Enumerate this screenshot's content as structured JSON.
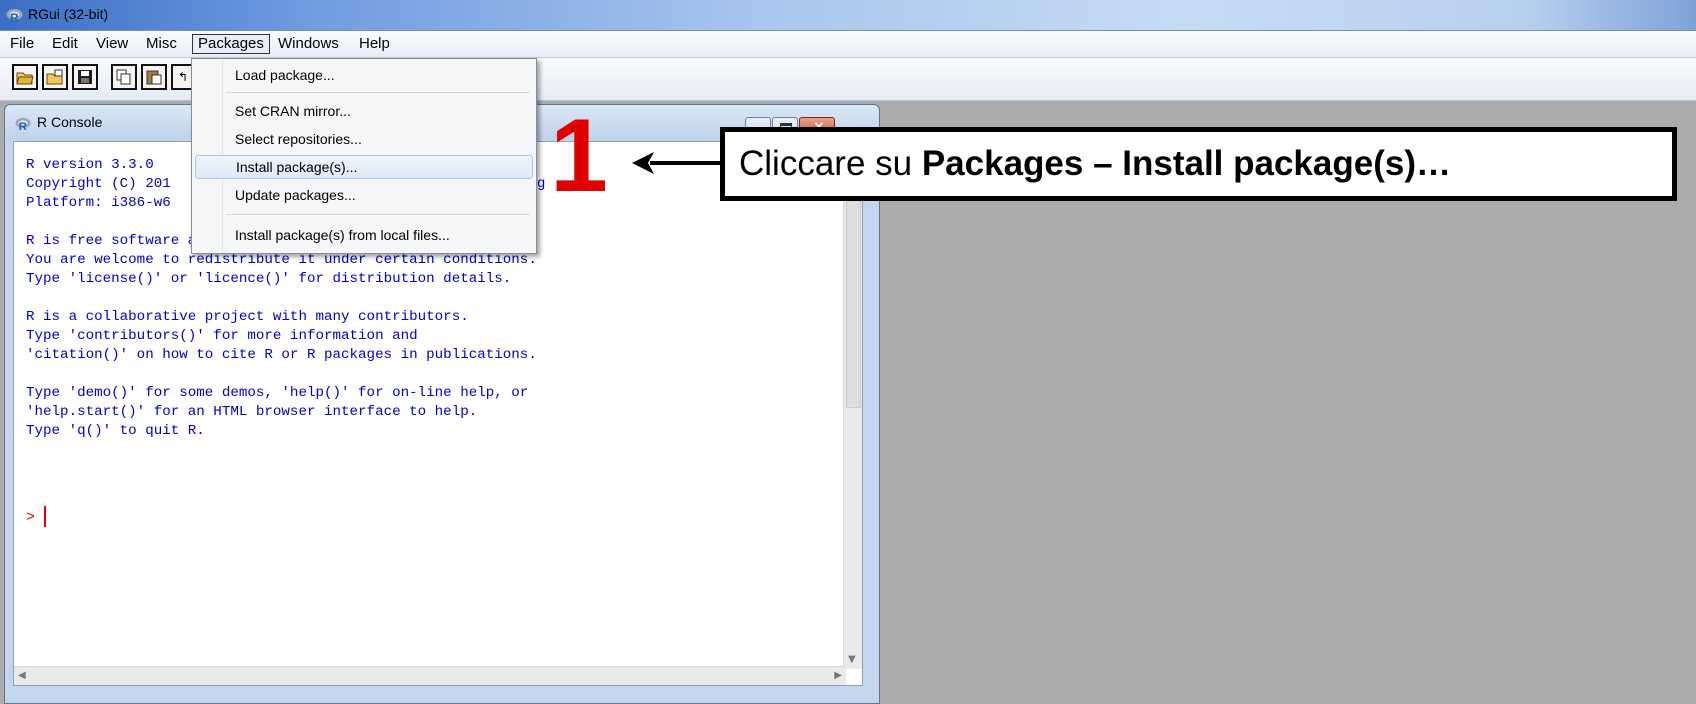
{
  "app": {
    "title": "RGui (32-bit)",
    "icon": "r-logo-icon"
  },
  "menubar": {
    "items": [
      "File",
      "Edit",
      "View",
      "Misc",
      "Packages",
      "Windows",
      "Help"
    ],
    "active": "Packages"
  },
  "toolbar": {
    "buttons": [
      "open-script-icon",
      "load-workspace-icon",
      "save-icon",
      "copy-icon",
      "paste-icon",
      "copy-paste-icon"
    ]
  },
  "packages_menu": {
    "items": [
      {
        "label": "Load package..."
      },
      {
        "label": "Set CRAN mirror..."
      },
      {
        "label": "Select repositories..."
      },
      {
        "label": "Install package(s)...",
        "highlighted": true
      },
      {
        "label": "Update packages..."
      },
      {
        "label": "Install package(s) from local files..."
      }
    ]
  },
  "console": {
    "title": "R Console",
    "lines": [
      "R version 3.3.0                                   ional",
      "Copyright (C) 201                                 1 Computing",
      "Platform: i386-w6",
      "",
      "R is free software and comes with ABSOLUTELY NO WARRANTY.",
      "You are welcome to redistribute it under certain conditions.",
      "Type 'license()' or 'licence()' for distribution details.",
      "",
      "R is a collaborative project with many contributors.",
      "Type 'contributors()' for more information and",
      "'citation()' on how to cite R or R packages in publications.",
      "",
      "Type 'demo()' for some demos, 'help()' for on-line help, or",
      "'help.start()' for an HTML browser interface to help.",
      "Type 'q()' to quit R."
    ],
    "prompt": ">"
  },
  "annotation": {
    "step": "1",
    "text_prefix": "Cliccare su ",
    "text_bold": "Packages – Install package(s)…",
    "colors": {
      "step": "#e00000",
      "box_border": "#000000"
    }
  },
  "colors": {
    "console_text": "#0000cc",
    "prompt": "#e60000",
    "mdi_background": "#ababab"
  }
}
